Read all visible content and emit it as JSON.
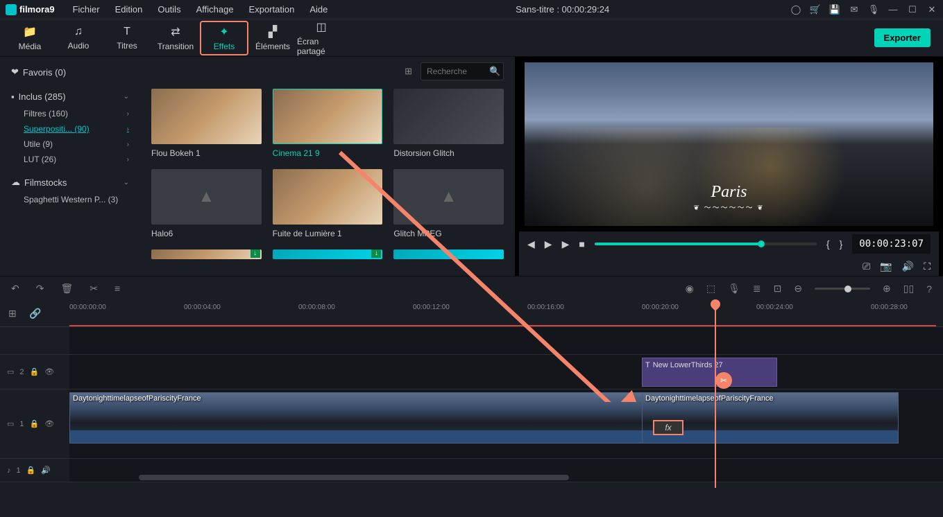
{
  "app": {
    "name": "filmora",
    "version": "9"
  },
  "menubar": [
    "Fichier",
    "Edition",
    "Outils",
    "Affichage",
    "Exportation",
    "Aide"
  ],
  "title": "Sans-titre : 00:00:29:24",
  "toolbar": {
    "tabs": [
      {
        "label": "Média",
        "icon": "folder"
      },
      {
        "label": "Audio",
        "icon": "music"
      },
      {
        "label": "Titres",
        "icon": "text"
      },
      {
        "label": "Transition",
        "icon": "transition"
      },
      {
        "label": "Effets",
        "icon": "sparkle",
        "active": true
      },
      {
        "label": "Éléments",
        "icon": "image"
      },
      {
        "label": "Écran partagé",
        "icon": "split"
      }
    ],
    "export": "Exporter"
  },
  "sidebar": {
    "favoris": "Favoris (0)",
    "inclus": "Inclus (285)",
    "subs": [
      {
        "label": "Filtres (160)"
      },
      {
        "label": "Superpositi... (90)",
        "active": true
      },
      {
        "label": "Utile (9)"
      },
      {
        "label": "LUT (26)"
      }
    ],
    "filmstocks": "Filmstocks",
    "spaghetti": "Spaghetti Western P... (3)"
  },
  "search": {
    "placeholder": "Recherche"
  },
  "effects": [
    {
      "name": "Flou Bokeh 1"
    },
    {
      "name": "Cinema 21 9",
      "active": true
    },
    {
      "name": "Distorsion Glitch"
    },
    {
      "name": "Halo6",
      "gray": true
    },
    {
      "name": "Fuite de Lumière 1"
    },
    {
      "name": "Glitch MPEG",
      "gray": true
    }
  ],
  "preview": {
    "overlay_text": "Paris",
    "timecode": "00:00:23:07"
  },
  "timeline": {
    "ruler": [
      "00:00:00:00",
      "00:00:04:00",
      "00:00:08:00",
      "00:00:12:00",
      "00:00:16:00",
      "00:00:20:00",
      "00:00:24:00",
      "00:00:28:00"
    ],
    "tracks": {
      "title_track": "2",
      "video_track": "1",
      "audio_track": "1"
    },
    "title_clip": "New LowerThirds 27",
    "video_clip1": "DaytonighttimelapseofPariscityFrance",
    "video_clip2": "DaytonighttimelapseofPariscityFrance",
    "fx_label": "fx"
  }
}
